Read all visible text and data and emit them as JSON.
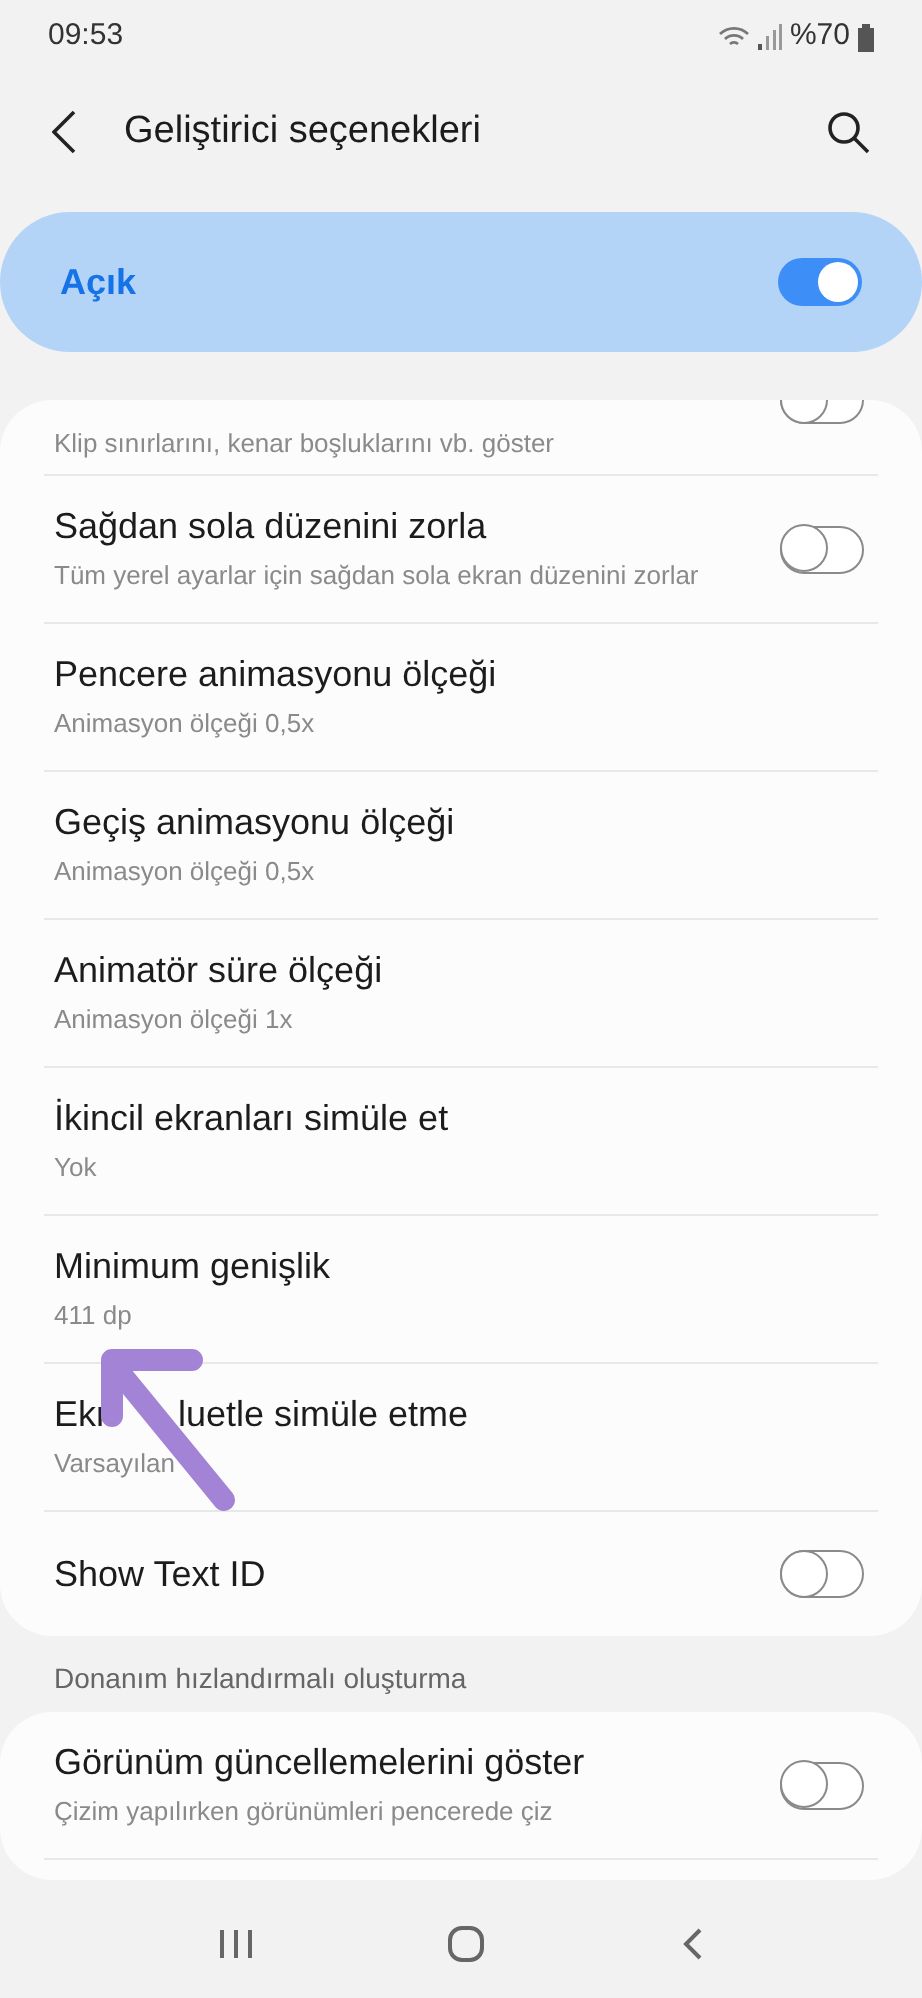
{
  "status_bar": {
    "time": "09:53",
    "battery": "%70"
  },
  "header": {
    "title": "Geliştirici seçenekleri"
  },
  "master_switch": {
    "label": "Açık",
    "on": true
  },
  "settings": [
    {
      "kind": "partial",
      "subtitle": "Klip sınırlarını, kenar boşluklarını vb. göster",
      "on": false
    },
    {
      "kind": "toggle",
      "title": "Sağdan sola düzenini zorla",
      "subtitle": "Tüm yerel ayarlar için sağdan sola ekran düzenini zorlar",
      "on": false
    },
    {
      "kind": "value",
      "title": "Pencere animasyonu ölçeği",
      "subtitle": "Animasyon ölçeği 0,5x"
    },
    {
      "kind": "value",
      "title": "Geçiş animasyonu ölçeği",
      "subtitle": "Animasyon ölçeği 0,5x"
    },
    {
      "kind": "value",
      "title": "Animatör süre ölçeği",
      "subtitle": "Animasyon ölçeği 1x"
    },
    {
      "kind": "value",
      "title": "İkincil ekranları simüle et",
      "subtitle": "Yok"
    },
    {
      "kind": "value",
      "title": "Minimum genişlik",
      "subtitle": "411 dp"
    },
    {
      "kind": "covered",
      "title": "Ekr",
      "title_rest": "luetle simüle etme",
      "subtitle": "Varsayılan"
    },
    {
      "kind": "toggle",
      "title": "Show Text ID",
      "on": false
    }
  ],
  "section": {
    "title": "Donanım hızlandırmalı oluşturma",
    "settings": [
      {
        "kind": "toggle",
        "title": "Görünüm güncellemelerini göster",
        "subtitle": "Çizim yapılırken görünümleri pencerede çiz",
        "on": false
      }
    ]
  }
}
